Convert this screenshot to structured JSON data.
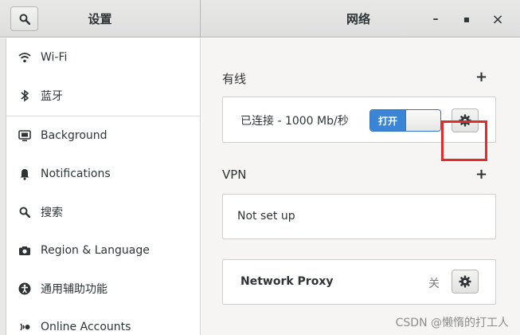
{
  "header": {
    "left_title": "设置",
    "right_title": "网络",
    "search_icon": "search-icon",
    "minimize_label": "–",
    "maximize_label": "▪",
    "close_label": "×"
  },
  "sidebar": {
    "items": [
      {
        "label": "Wi-Fi",
        "icon": "wifi-icon"
      },
      {
        "label": "蓝牙",
        "icon": "bluetooth-icon"
      },
      {
        "label": "Background",
        "icon": "monitor-icon"
      },
      {
        "label": "Notifications",
        "icon": "bell-icon"
      },
      {
        "label": "搜索",
        "icon": "search-icon"
      },
      {
        "label": "Region & Language",
        "icon": "camera-icon"
      },
      {
        "label": "通用辅助功能",
        "icon": "accessibility-icon"
      },
      {
        "label": "Online Accounts",
        "icon": "online-accounts-icon"
      }
    ]
  },
  "wired": {
    "title": "有线",
    "add_label": "+",
    "status": "已连接 - 1000 Mb/秒",
    "toggle_label": "打开",
    "toggle_on": true,
    "highlight_color": "#e22b2b"
  },
  "vpn": {
    "title": "VPN",
    "add_label": "+",
    "status": "Not set up"
  },
  "proxy": {
    "title": "Network Proxy",
    "status": "关"
  },
  "watermark": "CSDN @懒惰的打工人",
  "colors": {
    "accent": "#3a85d6",
    "highlight": "#e22b2b"
  }
}
